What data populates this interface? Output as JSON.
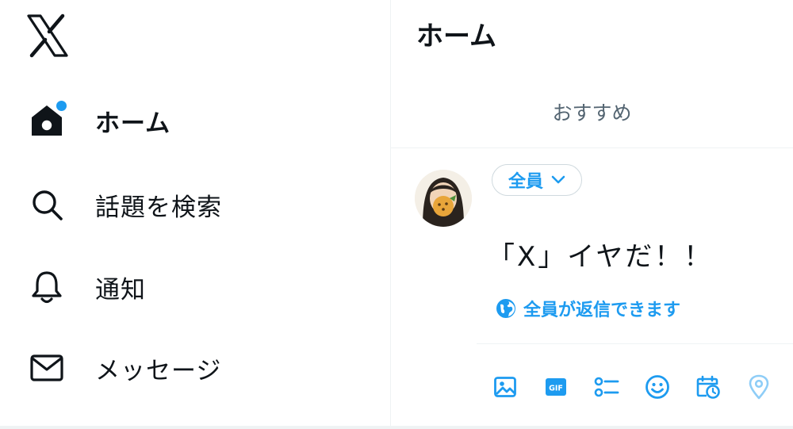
{
  "sidebar": {
    "logo_icon": "x-logo-icon",
    "items": [
      {
        "label": "ホーム",
        "icon": "home-icon",
        "active": true,
        "has_notification_dot": true
      },
      {
        "label": "話題を検索",
        "icon": "search-icon"
      },
      {
        "label": "通知",
        "icon": "bell-icon"
      },
      {
        "label": "メッセージ",
        "icon": "envelope-icon"
      }
    ]
  },
  "main": {
    "title": "ホーム",
    "tabs": [
      {
        "label": "おすすめ"
      }
    ],
    "composer": {
      "audience_label": "全員",
      "text": "「X」イヤだ！！",
      "reply_setting_label": "全員が返信できます",
      "toolbar_icons": [
        "image-icon",
        "gif-icon",
        "poll-icon",
        "emoji-icon",
        "schedule-icon",
        "location-icon"
      ]
    }
  },
  "colors": {
    "accent": "#1d9bf0",
    "text": "#0f1419",
    "secondary_text": "#536471",
    "border": "#eff3f4"
  }
}
